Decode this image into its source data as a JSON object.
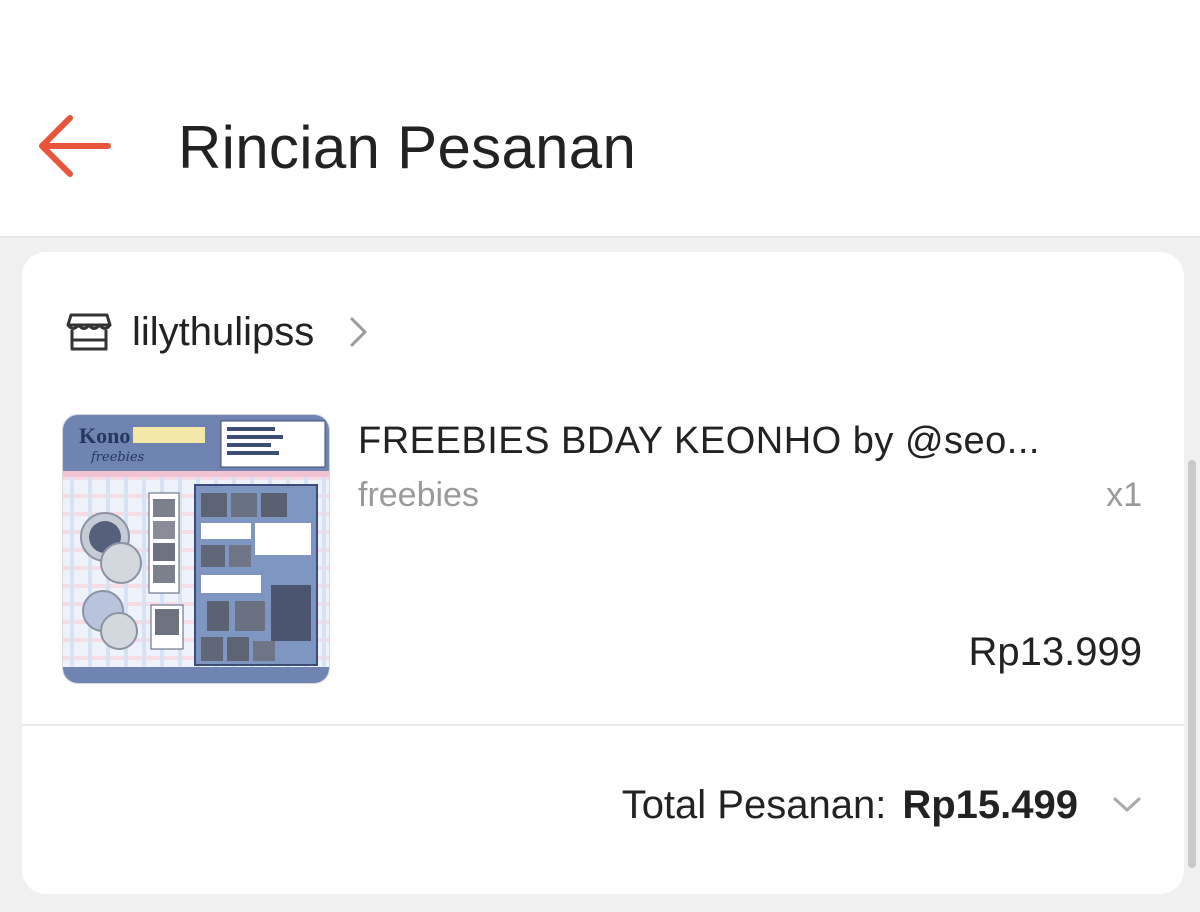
{
  "header": {
    "back_icon": "arrow-left-icon",
    "title": "Rincian Pesanan",
    "accent_color": "#e8553a"
  },
  "order": {
    "shop": {
      "icon": "store-icon",
      "name": "lilythulipss",
      "chevron_icon": "chevron-right-icon"
    },
    "product": {
      "image_icon": "product-thumbnail",
      "title": "FREEBIES BDAY KEONHO by @seo...",
      "variant": "freebies",
      "quantity": "x1",
      "price": "Rp13.999"
    },
    "total": {
      "label": "Total Pesanan:",
      "value": "Rp15.499",
      "chevron_icon": "chevron-down-icon"
    }
  }
}
